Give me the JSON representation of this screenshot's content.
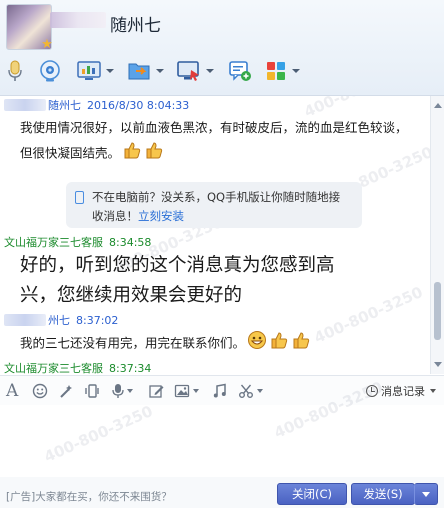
{
  "header": {
    "contact_name": "随州七"
  },
  "toolbar": {
    "buttons": [
      {
        "icon": "microphone-icon"
      },
      {
        "icon": "camera-icon"
      },
      {
        "icon": "screen-share-icon"
      },
      {
        "icon": "file-transfer-icon"
      },
      {
        "icon": "remote-desktop-icon"
      },
      {
        "icon": "message-add-icon"
      },
      {
        "icon": "apps-icon"
      }
    ]
  },
  "messages": [
    {
      "sender": "随州七",
      "time": "2016/8/30 8:04:33",
      "lines": [
        "我使用情况很好，以前血液色黑浓，有时破皮后，流的血是红色较谈，",
        "但很快凝固结壳。"
      ]
    },
    {
      "system_tip": {
        "line1": "不在电脑前？没关系，QQ手机版让你随时随地接",
        "line2": "收消息！",
        "link": "立刻安装"
      }
    },
    {
      "sender": "文山福万家三七客服",
      "time": "8:34:58",
      "lines": [
        "好的，听到您的这个消息真为您感到高",
        "兴，您继续用效果会更好的"
      ]
    },
    {
      "sender": "州七",
      "time": "8:37:02",
      "lines": [
        "我的三七还没有用完，用完在联系你们。"
      ]
    },
    {
      "sender": "文山福万家三七客服",
      "time": "8:37:34"
    }
  ],
  "input_toolbar": {
    "history_label": "消息记录"
  },
  "footer": {
    "ad_text": "[广告]大家都在买，你还不来围货？",
    "close_label": "关闭(C)",
    "send_label": "发送(S)"
  },
  "watermark": {
    "text": "400-800-3250"
  },
  "colors": {
    "sender_blue": "#2b5fcf",
    "sender_green": "#1b8b2c",
    "button_blue": "#4a62c2",
    "link_blue": "#2a6fd6"
  }
}
